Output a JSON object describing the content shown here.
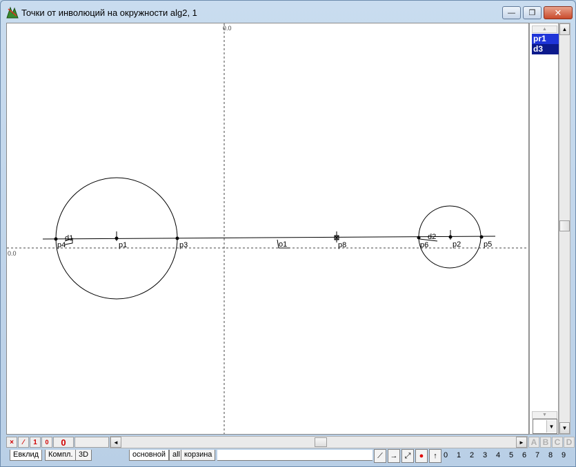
{
  "window": {
    "title": "Точки от инволюций на окружности alg2, 1",
    "minimize_glyph": "—",
    "maximize_glyph": "❐",
    "close_glyph": "✕"
  },
  "canvas": {
    "axis_label_x": "0.0",
    "axis_label_y": "0.0",
    "point_labels": {
      "d1": "d1",
      "p4": "p4",
      "p1": "p1",
      "p3": "p3",
      "o1": "o1",
      "p8": "p8",
      "p6": "p6",
      "d2": "d2",
      "p2": "p2",
      "p5": "p5"
    }
  },
  "object_list": {
    "items": [
      "pr1",
      "d3"
    ],
    "scroll_up_glyph": "▲",
    "scroll_down_glyph": "▼",
    "combo_arrow_glyph": "▼"
  },
  "vscroll": {
    "up_glyph": "▲",
    "down_glyph": "▼",
    "position_fraction": 0.5
  },
  "hscroll": {
    "left_glyph": "◄",
    "right_glyph": "►",
    "position_fraction": 0.5
  },
  "status_buttons": {
    "delete": "×",
    "line": "⁄",
    "one": "1",
    "zero_small": "0",
    "zero_big": "0"
  },
  "layer_letters": [
    "A",
    "B",
    "C",
    "D"
  ],
  "mode_tabs": [
    "Евклид",
    "Компл.",
    "3D"
  ],
  "sheet_tabs": [
    "основной",
    "all",
    "корзина"
  ],
  "tools": {
    "segment": "⟋",
    "arrow": "→",
    "stretch": "⤢",
    "point": "●",
    "up": "↑"
  },
  "digits": [
    "0",
    "1",
    "2",
    "3",
    "4",
    "5",
    "6",
    "7",
    "8",
    "9"
  ]
}
